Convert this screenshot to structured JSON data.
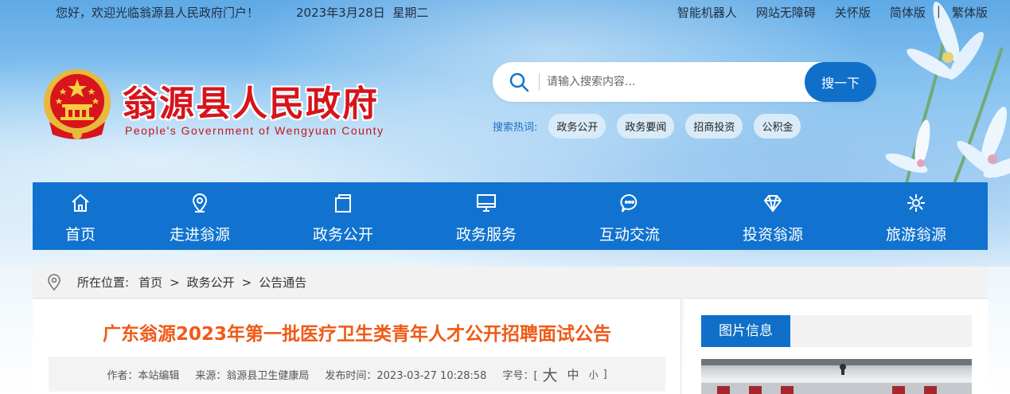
{
  "topbar": {
    "welcome": "您好，欢迎光临翁源县人民政府门户！",
    "date": "2023年3月28日  星期二",
    "links": [
      "智能机器人",
      "网站无障碍",
      "关怀版",
      "简体版",
      "繁体版"
    ],
    "separator": "|"
  },
  "brand": {
    "title": "翁源县人民政府",
    "subtitle": "People's Government of Wengyuan County"
  },
  "search": {
    "placeholder": "请输入搜索内容...",
    "button": "搜一下",
    "hot_label": "搜索热词:",
    "hot_words": [
      "政务公开",
      "政务要闻",
      "招商投资",
      "公积金"
    ]
  },
  "nav": {
    "items": [
      {
        "label": "首页",
        "icon": "home-icon"
      },
      {
        "label": "走进翁源",
        "icon": "location-icon"
      },
      {
        "label": "政务公开",
        "icon": "document-icon"
      },
      {
        "label": "政务服务",
        "icon": "monitor-icon"
      },
      {
        "label": "互动交流",
        "icon": "chat-icon"
      },
      {
        "label": "投资翁源",
        "icon": "diamond-icon"
      },
      {
        "label": "旅游翁源",
        "icon": "flower-icon"
      }
    ]
  },
  "breadcrumb": {
    "prefix": "所在位置:",
    "items": [
      "首页",
      "政务公开",
      "公告通告"
    ],
    "sep": ">"
  },
  "article": {
    "title": "广东翁源2023年第一批医疗卫生类青年人才公开招聘面试公告",
    "author": "作者：本站编辑",
    "source": "来源：翁源县卫生健康局",
    "published": "发布时间：2023-03-27 10:28:58",
    "font_label": "字号：[",
    "font_big": "大",
    "font_mid": "中",
    "font_small": "小",
    "font_end": "]"
  },
  "sidebar": {
    "heading": "图片信息"
  },
  "colors": {
    "brand_blue": "#1173cf",
    "title_red": "#d6141b",
    "article_orange": "#ef5a17"
  }
}
